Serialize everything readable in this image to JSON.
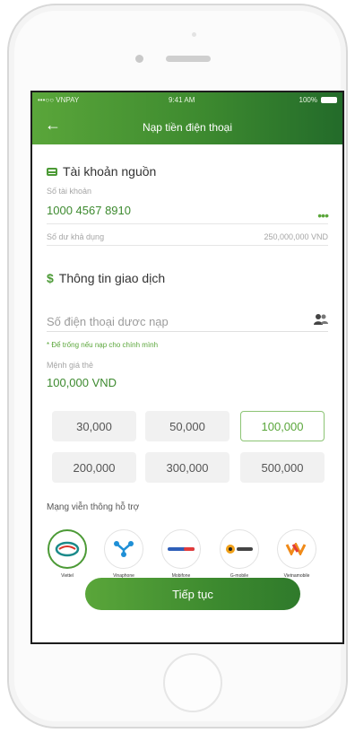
{
  "status_bar": {
    "carrier": "•••○○ VNPAY",
    "time": "9:41 AM",
    "battery": "100%"
  },
  "header": {
    "title": "Nạp tiền điện thoại"
  },
  "source_account": {
    "title": "Tài khoản nguồn",
    "account_label": "Số tài khoản",
    "account_number": "1000 4567 8910",
    "more": "•••",
    "balance_label": "Số dư khả dụng",
    "balance_value": "250,000,000 VND"
  },
  "transaction": {
    "title": "Thông tin giao dịch",
    "phone_placeholder": "Số điện thoại dươc nạp",
    "hint": "* Để trống nếu nạp cho chính mình",
    "denomination_label": "Mệnh giá thẻ",
    "denomination_value": "100,000 VND",
    "options": [
      "30,000",
      "50,000",
      "100,000",
      "200,000",
      "300,000",
      "500,000"
    ],
    "selected_option": "100,000"
  },
  "networks": {
    "title": "Mạng viễn thông hỗ trợ",
    "items": [
      {
        "name": "Viettel",
        "icon": "viettel-logo",
        "selected": true
      },
      {
        "name": "Vinaphone",
        "icon": "vinaphone-logo",
        "selected": false
      },
      {
        "name": "Mobifone",
        "icon": "mobifone-logo",
        "selected": false
      },
      {
        "name": "G-mobile",
        "icon": "gmobile-logo",
        "selected": false
      },
      {
        "name": "Vietnamobile",
        "icon": "vietnamobile-logo",
        "selected": false
      }
    ]
  },
  "actions": {
    "continue_label": "Tiếp tục"
  },
  "colors": {
    "accent": "#4c9a36",
    "accent_dark": "#236b2a",
    "text": "#333333"
  }
}
